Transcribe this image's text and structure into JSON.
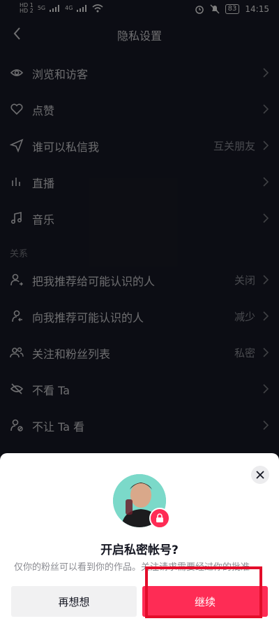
{
  "statusbar": {
    "left_small_top": "HD 1",
    "left_small_bottom": "HD 2",
    "sig1": "5G",
    "sig2": "4G",
    "battery": "83",
    "time": "14:15"
  },
  "nav": {
    "title": "隐私设置"
  },
  "rows": [
    {
      "label": "浏览和访客",
      "value": "",
      "icon": "eye-icon"
    },
    {
      "label": "点赞",
      "value": "",
      "icon": "heart-icon"
    },
    {
      "label": "谁可以私信我",
      "value": "互关朋友",
      "icon": "send-icon"
    },
    {
      "label": "直播",
      "value": "",
      "icon": "live-bars-icon"
    },
    {
      "label": "音乐",
      "value": "",
      "icon": "music-icon"
    }
  ],
  "section": "关系",
  "rows2": [
    {
      "label": "把我推荐给可能认识的人",
      "value": "关闭",
      "icon": "recommend-me-icon"
    },
    {
      "label": "向我推荐可能认识的人",
      "value": "减少",
      "icon": "recommend-others-icon"
    },
    {
      "label": "关注和粉丝列表",
      "value": "私密",
      "icon": "users-icon"
    },
    {
      "label": "不看 Ta",
      "value": "",
      "icon": "eye-off-icon"
    },
    {
      "label": "不让 Ta 看",
      "value": "",
      "icon": "user-block-icon"
    }
  ],
  "sheet": {
    "title": "开启私密帐号?",
    "desc": "仅你的粉丝可以看到你的作品。关注请求需要经过你的批准",
    "cancel": "再想想",
    "continue": "继续"
  },
  "colors": {
    "accent": "#fe2c55",
    "bg": "#161823",
    "highlight": "#e30d2a"
  }
}
